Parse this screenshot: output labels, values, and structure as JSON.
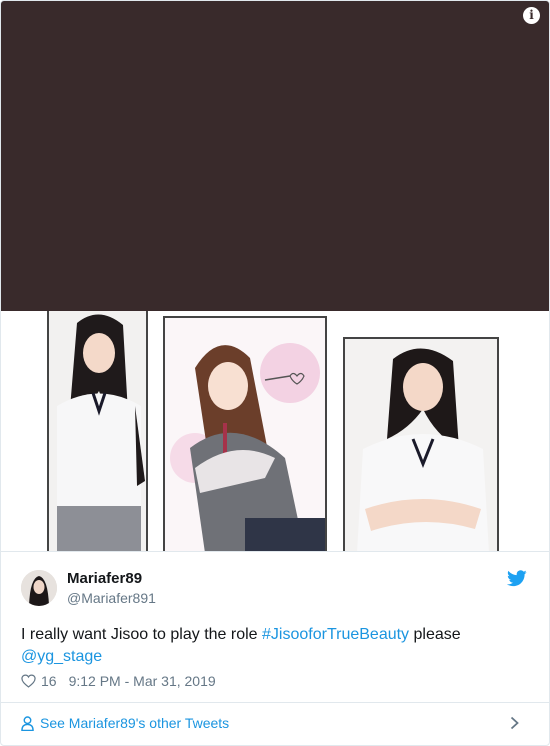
{
  "media": {
    "info_icon": "info-icon",
    "info_glyph": "i"
  },
  "tweet": {
    "display_name": "Mariafer89",
    "handle": "@Mariafer891",
    "text_part1": "I really want Jisoo to play the role ",
    "hashtag": "#JisooforTrueBeauty",
    "text_part2": " please",
    "mention": "@yg_stage",
    "likes": "16",
    "timestamp": "9:12 PM - Mar 31, 2019",
    "see_more": "See Mariafer89's other Tweets"
  },
  "colors": {
    "link": "#1b95e0",
    "muted": "#657786",
    "media_dark": "#392a2b"
  },
  "icons": [
    "info-icon",
    "twitter-bird-icon",
    "heart-icon",
    "person-icon",
    "chevron-right-icon"
  ]
}
